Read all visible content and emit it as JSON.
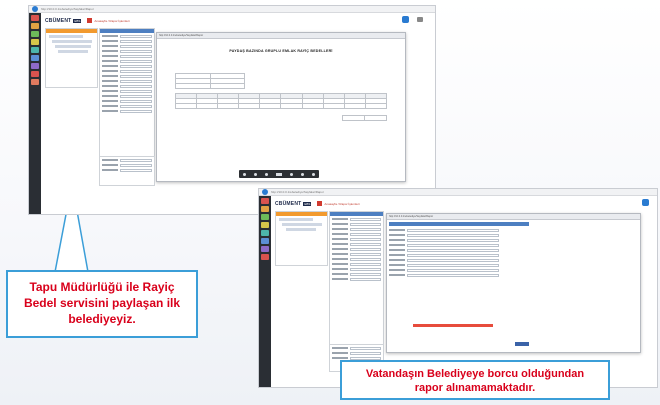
{
  "screenshot_1": {
    "url_text": "http://10.0.0.1/ebelediye/Sayfalar/Rapor",
    "app_logo": "CBÜMENT",
    "app_logo_badge": "EBS",
    "app_title": "Anasayfa / Rapor İşlemleri",
    "report": {
      "title": "PAYDAŞ BAZINDA GRUPLU EMLAK RAYİÇ BEDELLERİ"
    }
  },
  "screenshot_2": {
    "url_text": "http://10.0.0.1/ebelediye/Sayfalar/Rapor",
    "app_logo": "CBÜMENT",
    "app_logo_badge": "EBS",
    "app_title": "Anasayfa / Rapor İşlemleri"
  },
  "callout_left": {
    "text": "Tapu Müdürlüğü ile Rayiç Bedel servisini paylaşan ilk belediyeyiz."
  },
  "callout_right": {
    "text": "Vatandaşın Belediyeye borcu olduğundan rapor alınamamaktadır."
  },
  "colors": {
    "callout_border": "#3b9ed8",
    "callout_text": "#d9001b",
    "accent_orange": "#f29a2e",
    "rail_dark": "#2a2e34"
  }
}
